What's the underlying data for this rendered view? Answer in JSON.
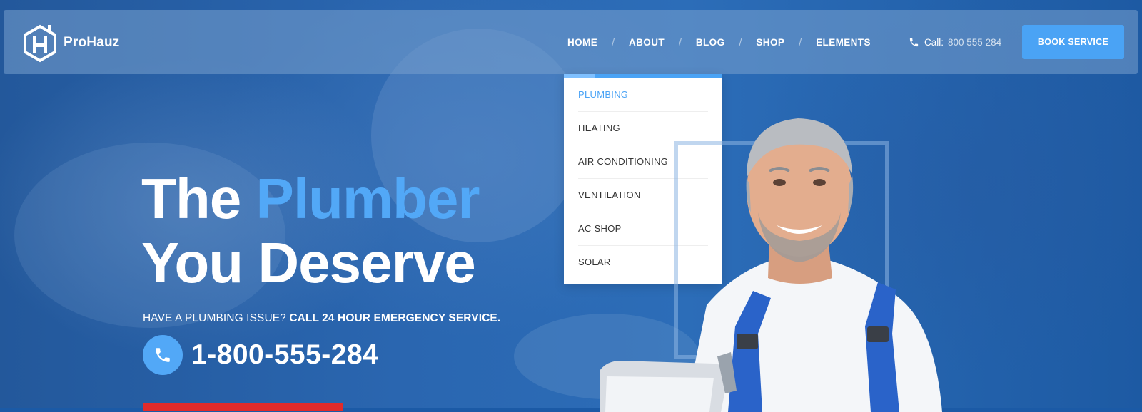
{
  "brand": {
    "name": "ProHauz",
    "logo_icon": "house-h-icon"
  },
  "nav": {
    "items": [
      "HOME",
      "ABOUT",
      "BLOG",
      "SHOP",
      "ELEMENTS"
    ],
    "separator": "/"
  },
  "call": {
    "label": "Call:",
    "number": "800 555 284",
    "icon": "phone-icon"
  },
  "book_button": {
    "label": "BOOK SERVICE"
  },
  "dropdown": {
    "items": [
      "PLUMBING",
      "HEATING",
      "AIR CONDITIONING",
      "VENTILATION",
      "AC SHOP",
      "SOLAR"
    ],
    "active": "PLUMBING"
  },
  "hero": {
    "title_line1_a": "The",
    "title_line1_b": "Plumber",
    "title_line2": "You Deserve",
    "subtitle_normal": "HAVE A PLUMBING ISSUE?",
    "subtitle_bold": "CALL 24 HOUR EMERGENCY SERVICE.",
    "phone": "1-800-555-284"
  },
  "colors": {
    "accent": "#4aa3f5",
    "hero_accent": "#52a8f7",
    "cta_red": "#e02b2b"
  }
}
